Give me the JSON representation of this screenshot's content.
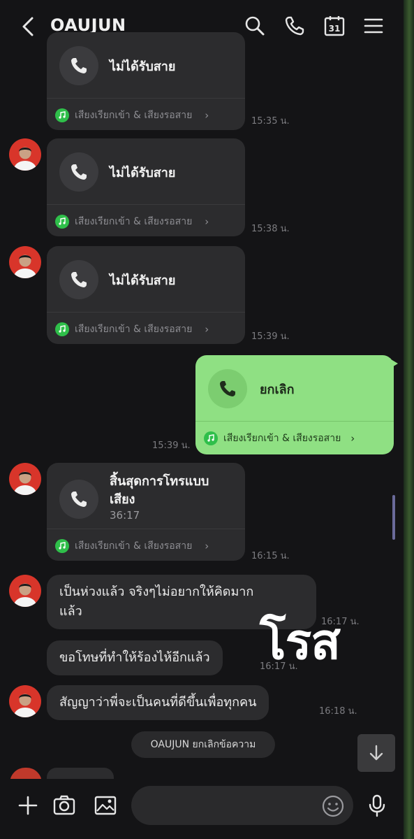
{
  "header": {
    "title": "OAUJUN",
    "icons": [
      "back-icon",
      "search-icon",
      "phone-icon",
      "calendar-icon",
      "menu-icon"
    ],
    "calendar_day": "31"
  },
  "messages": [
    {
      "type": "call",
      "label": "ไม่ได้รับสาย",
      "footer": "เสียงเรียกเข้า & เสียงรอสาย",
      "time": "15:35 น."
    },
    {
      "type": "call",
      "label": "ไม่ได้รับสาย",
      "footer": "เสียงเรียกเข้า & เสียงรอสาย",
      "time": "15:38 น."
    },
    {
      "type": "call",
      "label": "ไม่ได้รับสาย",
      "footer": "เสียงเรียกเข้า & เสียงรอสาย",
      "time": "15:39 น."
    },
    {
      "type": "call-sent",
      "label": "ยกเลิก",
      "footer": "เสียงเรียกเข้า & เสียงรอสาย",
      "time": "15:39 น."
    },
    {
      "type": "call",
      "label_line1": "สิ้นสุดการโทรแบบ",
      "label_line2": "เสียง",
      "duration": "36:17",
      "footer": "เสียงเรียกเข้า & เสียงรอสาย",
      "time": "16:15 น."
    },
    {
      "type": "text",
      "line1": "เป็นห่วงแล้ว จริงๆไม่อยากให้คิดมาก",
      "line2": "แล้ว",
      "time": "16:17 น."
    },
    {
      "type": "text",
      "text": "ขอโทษที่ทำให้ร้องไห้อีกแล้ว",
      "time": "16:17 น."
    },
    {
      "type": "text",
      "text": "สัญญาว่าพี่จะเป็นคนที่ดีขึ้นเพื่อทุกคน",
      "time": "16:18 น."
    }
  ],
  "system_message": "OAUJUN ยกเลิกข้อความ",
  "overlay_text": "โรส",
  "input": {
    "placeholder": ""
  },
  "colors": {
    "sent_bubble": "#8fe083",
    "received_bubble": "#2c2c2e",
    "background": "#141416",
    "music_icon": "#2fbf4a"
  }
}
